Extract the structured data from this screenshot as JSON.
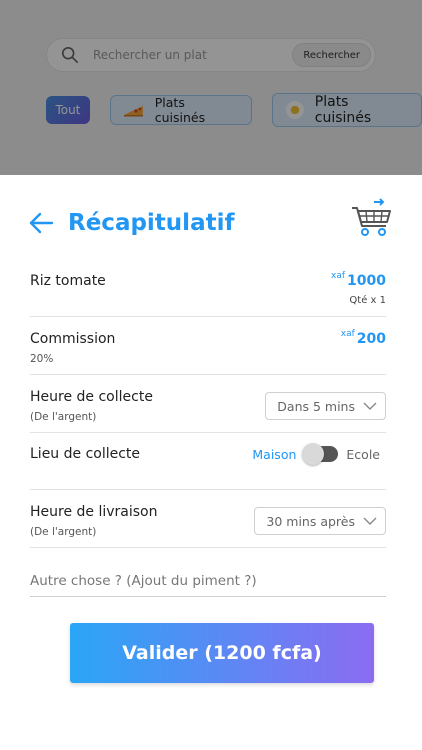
{
  "background": {
    "search": {
      "placeholder": "Rechercher un plat",
      "button_label": "Rechercher"
    },
    "categories": [
      {
        "label": "Tout",
        "icon": "all"
      },
      {
        "label": "Plats cuisinés",
        "icon": "pizza-icon"
      },
      {
        "label": "Plats cuisinés",
        "icon": "egg-icon"
      }
    ]
  },
  "sheet": {
    "title": "Récapitulatif",
    "items": {
      "product": {
        "name": "Riz tomate",
        "currency": "xaf",
        "price": "1000",
        "qty": "Qté x 1"
      },
      "commission": {
        "label": "Commission",
        "rate": "20%",
        "currency": "xaf",
        "price": "200"
      },
      "pickup_time": {
        "label": "Heure de collecte",
        "sub": "(De l'argent)",
        "value": "Dans 5 mins"
      },
      "pickup_place": {
        "label": "Lieu de collecte",
        "option_a": "Maison",
        "option_b": "Ecole"
      },
      "delivery_time": {
        "label": "Heure de livraison",
        "sub": "(De l'argent)",
        "value": "30 mins après"
      }
    },
    "note_placeholder": "Autre chose ? (Ajout du piment ?)",
    "submit_label": "Valider (1200 fcfa)"
  },
  "colors": {
    "accent": "#2196f3",
    "gradient_start": "#2aa6f6",
    "gradient_end": "#8b6cf2"
  }
}
